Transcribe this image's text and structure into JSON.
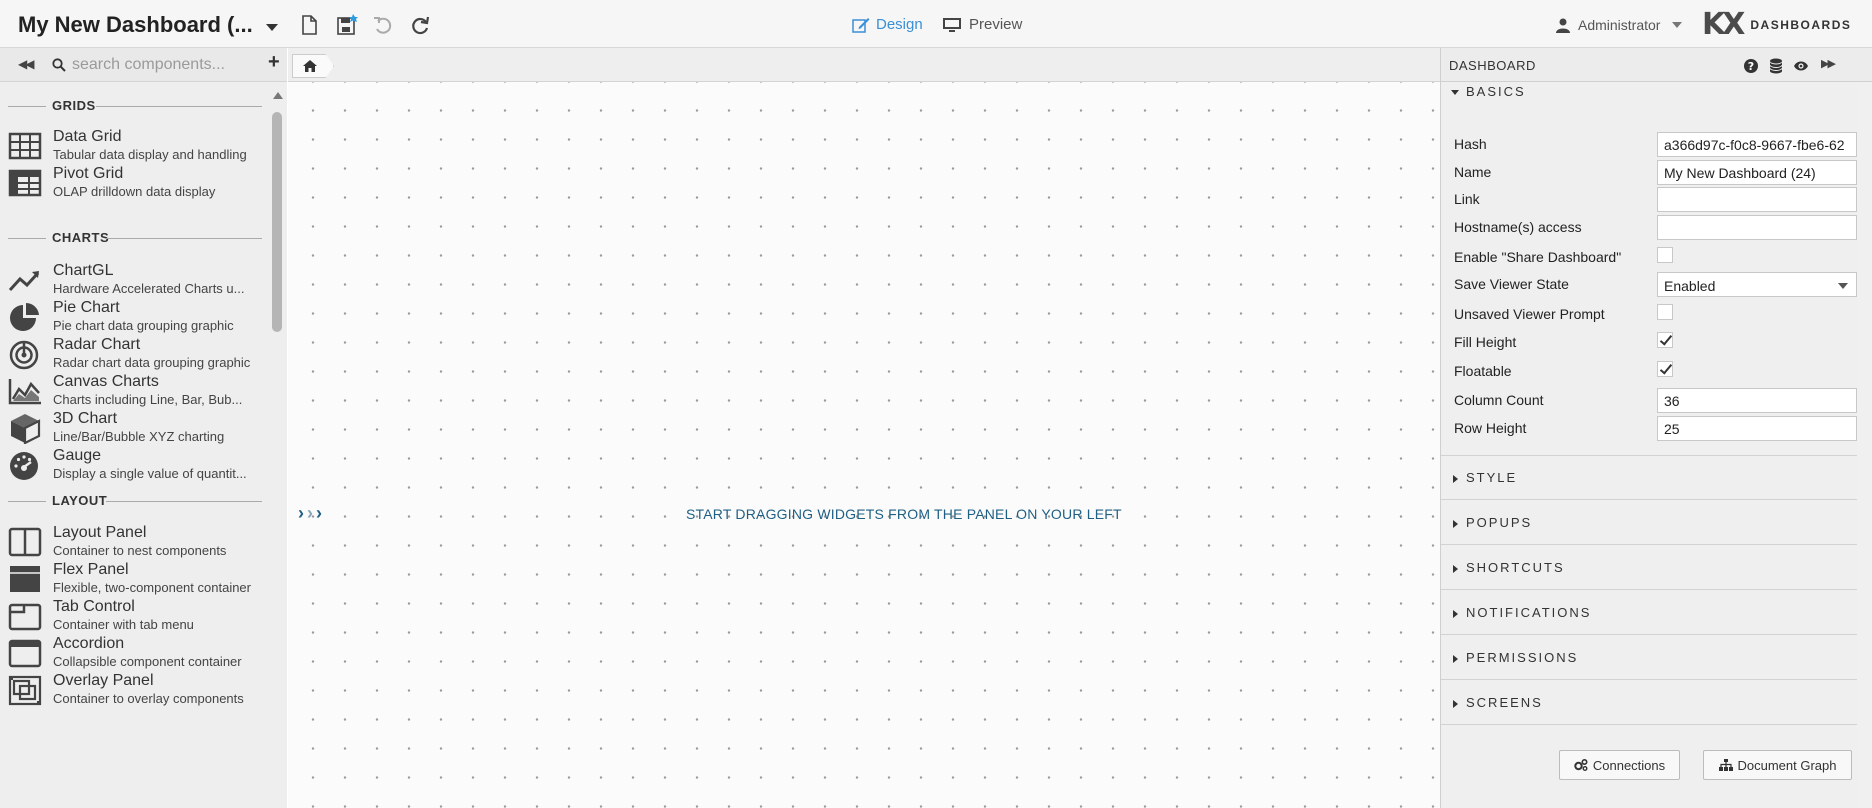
{
  "topbar": {
    "title": "My New Dashboard (...",
    "design_label": "Design",
    "preview_label": "Preview",
    "user_label": "Administrator",
    "brand_mark": "KX",
    "brand_text": "DASHBOARDS",
    "accent_color": "#3a8fd6"
  },
  "left_panel": {
    "search_placeholder": "search components...",
    "sections": {
      "grids": "GRIDS",
      "charts": "CHARTS",
      "layout": "LAYOUT"
    },
    "components": [
      {
        "name": "Data Grid",
        "desc": "Tabular data display and handling",
        "icon": "table-grid-icon"
      },
      {
        "name": "Pivot Grid",
        "desc": "OLAP drilldown data display",
        "icon": "pivot-grid-icon"
      },
      {
        "name": "ChartGL",
        "desc": "Hardware Accelerated Charts u...",
        "icon": "trend-line-icon"
      },
      {
        "name": "Pie Chart",
        "desc": "Pie chart data grouping graphic",
        "icon": "pie-chart-icon"
      },
      {
        "name": "Radar Chart",
        "desc": "Radar chart data grouping graphic",
        "icon": "radar-icon"
      },
      {
        "name": "Canvas Charts",
        "desc": "Charts including Line, Bar, Bub...",
        "icon": "area-chart-icon"
      },
      {
        "name": "3D Chart",
        "desc": "Line/Bar/Bubble XYZ charting",
        "icon": "cube-icon"
      },
      {
        "name": "Gauge",
        "desc": "Display a single value of quantit...",
        "icon": "gauge-icon"
      },
      {
        "name": "Layout Panel",
        "desc": "Container to nest components",
        "icon": "layout-panel-icon"
      },
      {
        "name": "Flex Panel",
        "desc": "Flexible, two-component container",
        "icon": "flex-panel-icon"
      },
      {
        "name": "Tab Control",
        "desc": "Container with tab menu",
        "icon": "tab-control-icon"
      },
      {
        "name": "Accordion",
        "desc": "Collapsible component container",
        "icon": "accordion-icon"
      },
      {
        "name": "Overlay Panel",
        "desc": "Container to overlay components",
        "icon": "overlay-panel-icon"
      }
    ]
  },
  "canvas": {
    "message": "START DRAGGING WIDGETS FROM THE PANEL ON YOUR LEFT"
  },
  "right_panel": {
    "title": "DASHBOARD",
    "sections": {
      "basics": "BASICS",
      "style": "STYLE",
      "popups": "POPUPS",
      "shortcuts": "SHORTCUTS",
      "notifications": "NOTIFICATIONS",
      "permissions": "PERMISSIONS",
      "screens": "SCREENS"
    },
    "props": {
      "hash_label": "Hash",
      "hash_value": "a366d97c-f0c8-9667-fbe6-62",
      "name_label": "Name",
      "name_value": "My New Dashboard (24)",
      "link_label": "Link",
      "link_value": "",
      "hostname_label": "Hostname(s) access",
      "hostname_value": "",
      "share_label": "Enable \"Share Dashboard\"",
      "share_checked": false,
      "save_state_label": "Save Viewer State",
      "save_state_value": "Enabled",
      "unsaved_label": "Unsaved Viewer Prompt",
      "unsaved_checked": false,
      "fill_height_label": "Fill Height",
      "fill_height_checked": true,
      "floatable_label": "Floatable",
      "floatable_checked": true,
      "column_count_label": "Column Count",
      "column_count_value": "36",
      "row_height_label": "Row Height",
      "row_height_value": "25"
    },
    "buttons": {
      "connections": "Connections",
      "document_graph": "Document Graph"
    }
  }
}
